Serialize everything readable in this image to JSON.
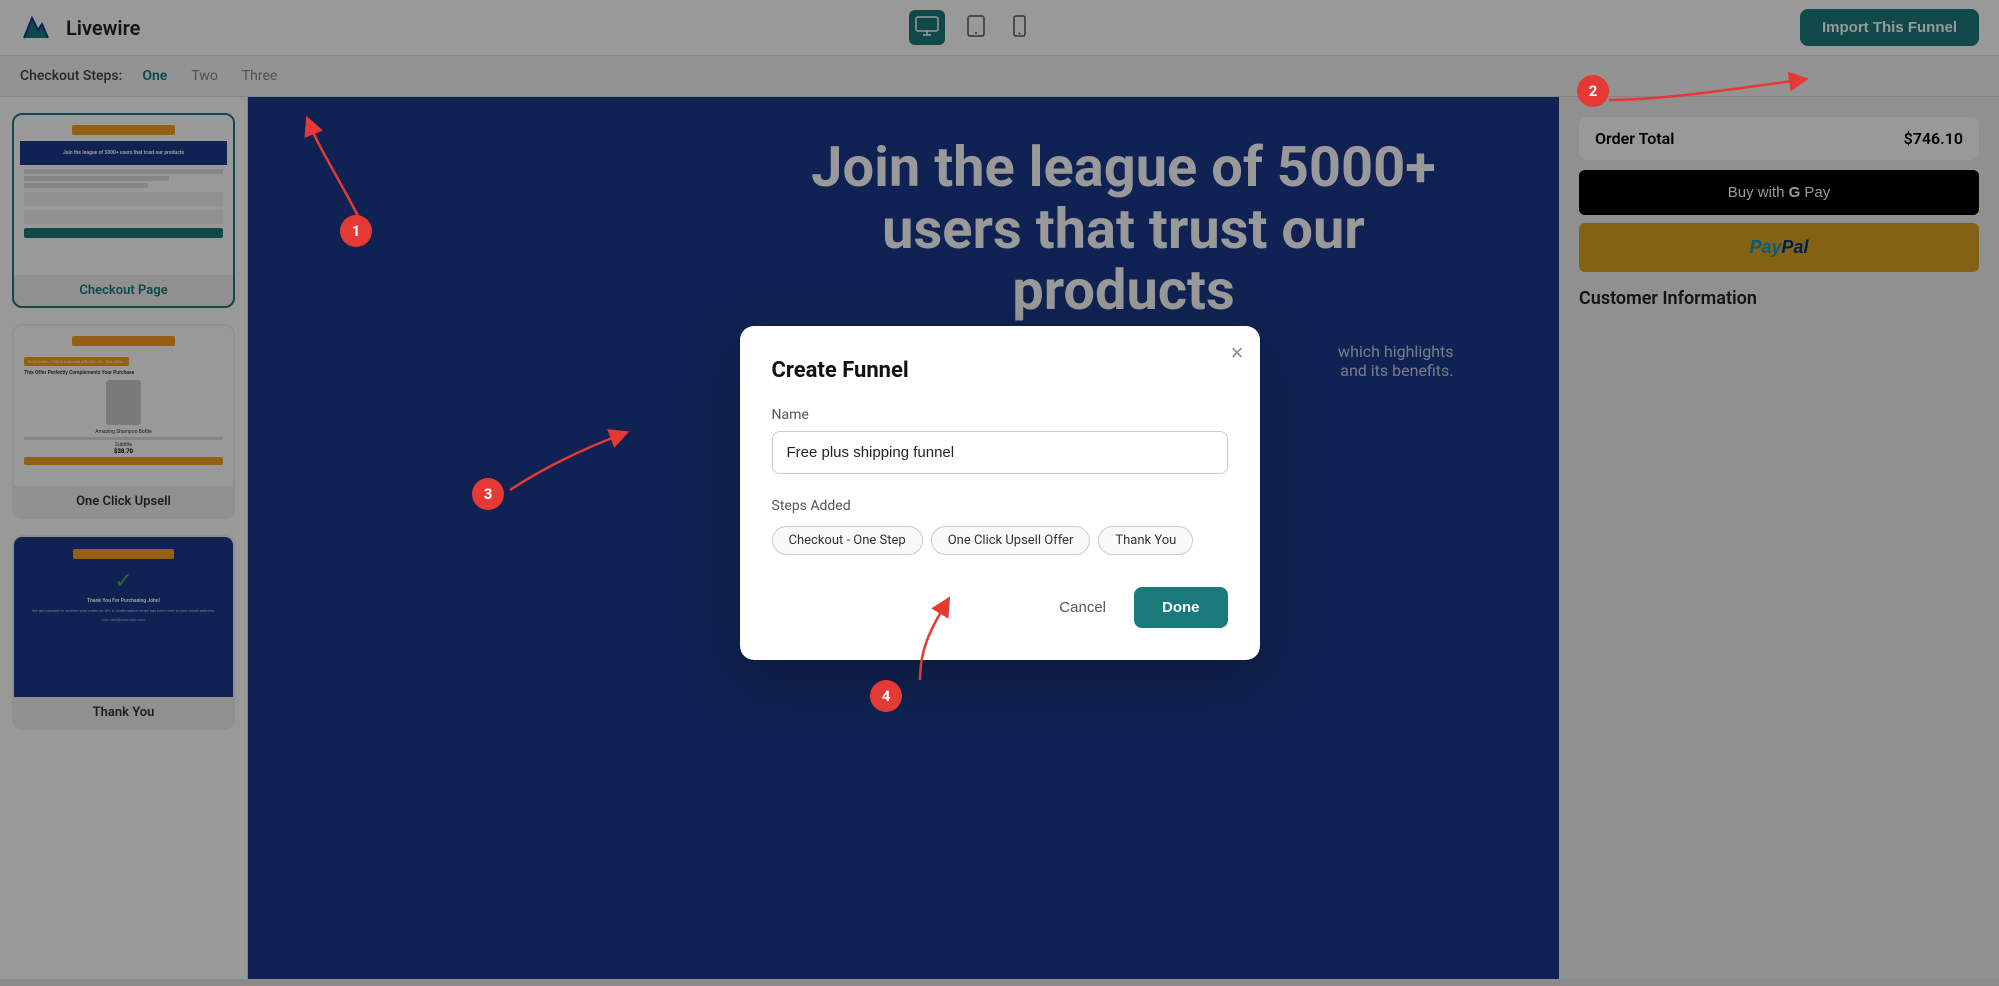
{
  "app": {
    "name": "Livewire"
  },
  "header": {
    "import_button": "Import This Funnel",
    "devices": [
      {
        "name": "desktop",
        "icon": "🖥",
        "active": true
      },
      {
        "name": "tablet",
        "icon": "⬜",
        "active": false
      },
      {
        "name": "mobile",
        "icon": "📱",
        "active": false
      }
    ]
  },
  "sub_header": {
    "label": "Checkout Steps:",
    "steps": [
      {
        "label": "One",
        "active": true
      },
      {
        "label": "Two",
        "active": false
      },
      {
        "label": "Three",
        "active": false
      }
    ]
  },
  "sidebar": {
    "cards": [
      {
        "id": "checkout",
        "label": "Checkout Page",
        "active": true
      },
      {
        "id": "upsell",
        "label": "One Click Upsell",
        "active": false
      },
      {
        "id": "thankyou",
        "label": "Thank You",
        "active": false
      }
    ]
  },
  "page_preview": {
    "hero_title": "Join the league of 5000+ users that trust our products",
    "hero_subtitle": "which highlights and its benefits.",
    "order_total": "$746.10",
    "gpay_label": "Buy with G Pay",
    "paypal_label": "PayPal",
    "customer_info_title": "Customer Information"
  },
  "modal": {
    "title": "Create Funnel",
    "name_label": "Name",
    "name_value": "Free plus shipping funnel",
    "steps_added_label": "Steps Added",
    "steps": [
      {
        "label": "Checkout - One Step"
      },
      {
        "label": "One Click Upsell Offer"
      },
      {
        "label": "Thank You"
      }
    ],
    "cancel_label": "Cancel",
    "done_label": "Done",
    "close_icon": "×"
  },
  "annotations": [
    {
      "number": "1",
      "description": "Checkout Steps One tab"
    },
    {
      "number": "2",
      "description": "Import This Funnel button"
    },
    {
      "number": "3",
      "description": "Free plus shipping funnel name input"
    },
    {
      "number": "4",
      "description": "Done button"
    }
  ]
}
